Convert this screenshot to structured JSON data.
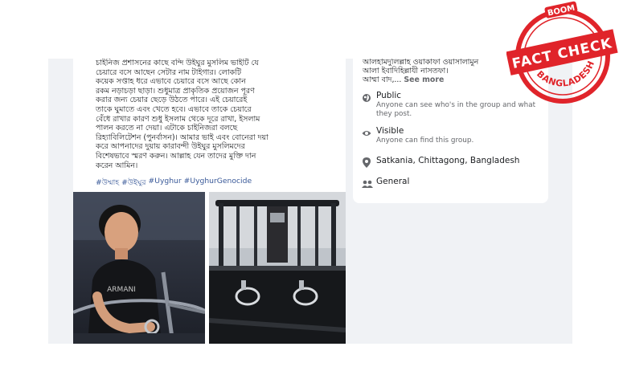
{
  "post": {
    "text": "চাইনিজ প্রশাসনের কাছে বন্দি উইঘুর মুসলিম ভাইটি যে\nচেয়ারে বসে আছেন সেটার নাম টাইগার। লোকটি\nকয়েক সপ্তাহ ধরে এভাবে চেয়ারে বসে আছে কোন\nরকম নড়াচড়া ছাড়া। শুধুমাত্র প্রাকৃতিক প্রয়োজন পূরণ\nকরার জন্য চেয়ার ছেড়ে উঠতে পারে। এই চেয়ারেই\nতাকে ঘুমাতে এবং খেতে হবে। এভাবে তাকে চেয়ারে\nবেঁধে রাখার কারণ শুধু ইসলাম থেকে দূরে রাখা, ইসলাম\nপালন করতে না দেয়া। এটাকে চাইনিজরা বলছে\nরিহ্যাবিলিটেশন (পুনর্বাসন)। আমার ভাই এবং বোনেরা দয়া\nকরে আপনাদের দুয়ায় কারাবন্দী উইঘুর মুসলিমদের\nবিশেষভাবে স্মরণ করুন। আল্লাহ যেন তাদের মুক্তি দান\nকরেন আমিন।",
    "hashtags": [
      "#উম্মাহ",
      "#উইঘুর",
      "#Uyghur",
      "#UyghurGenocide"
    ],
    "shirt_text": "ARMANI"
  },
  "group_info": {
    "about_text": "আলহামদুলিল্লাহ ওয়াকাফা ওয়াসালামুন\nআলা ইবাদিহিল্লাযী নাসতফা।\nআম্মা বাদ,...",
    "see_more": "See more",
    "privacy_title": "Public",
    "privacy_desc": "Anyone can see who's in the group and what they post.",
    "visibility_title": "Visible",
    "visibility_desc": "Anyone can find this group.",
    "location": "Satkania, Chittagong, Bangladesh",
    "category": "General"
  },
  "badge": {
    "top": "BOOM",
    "main": "FACT CHECK",
    "sub": "BANGLADESH",
    "color": "#e0242a"
  },
  "colors": {
    "page_bg": "#f0f2f5",
    "hashtag": "#385898",
    "muted_text": "#65676b"
  }
}
